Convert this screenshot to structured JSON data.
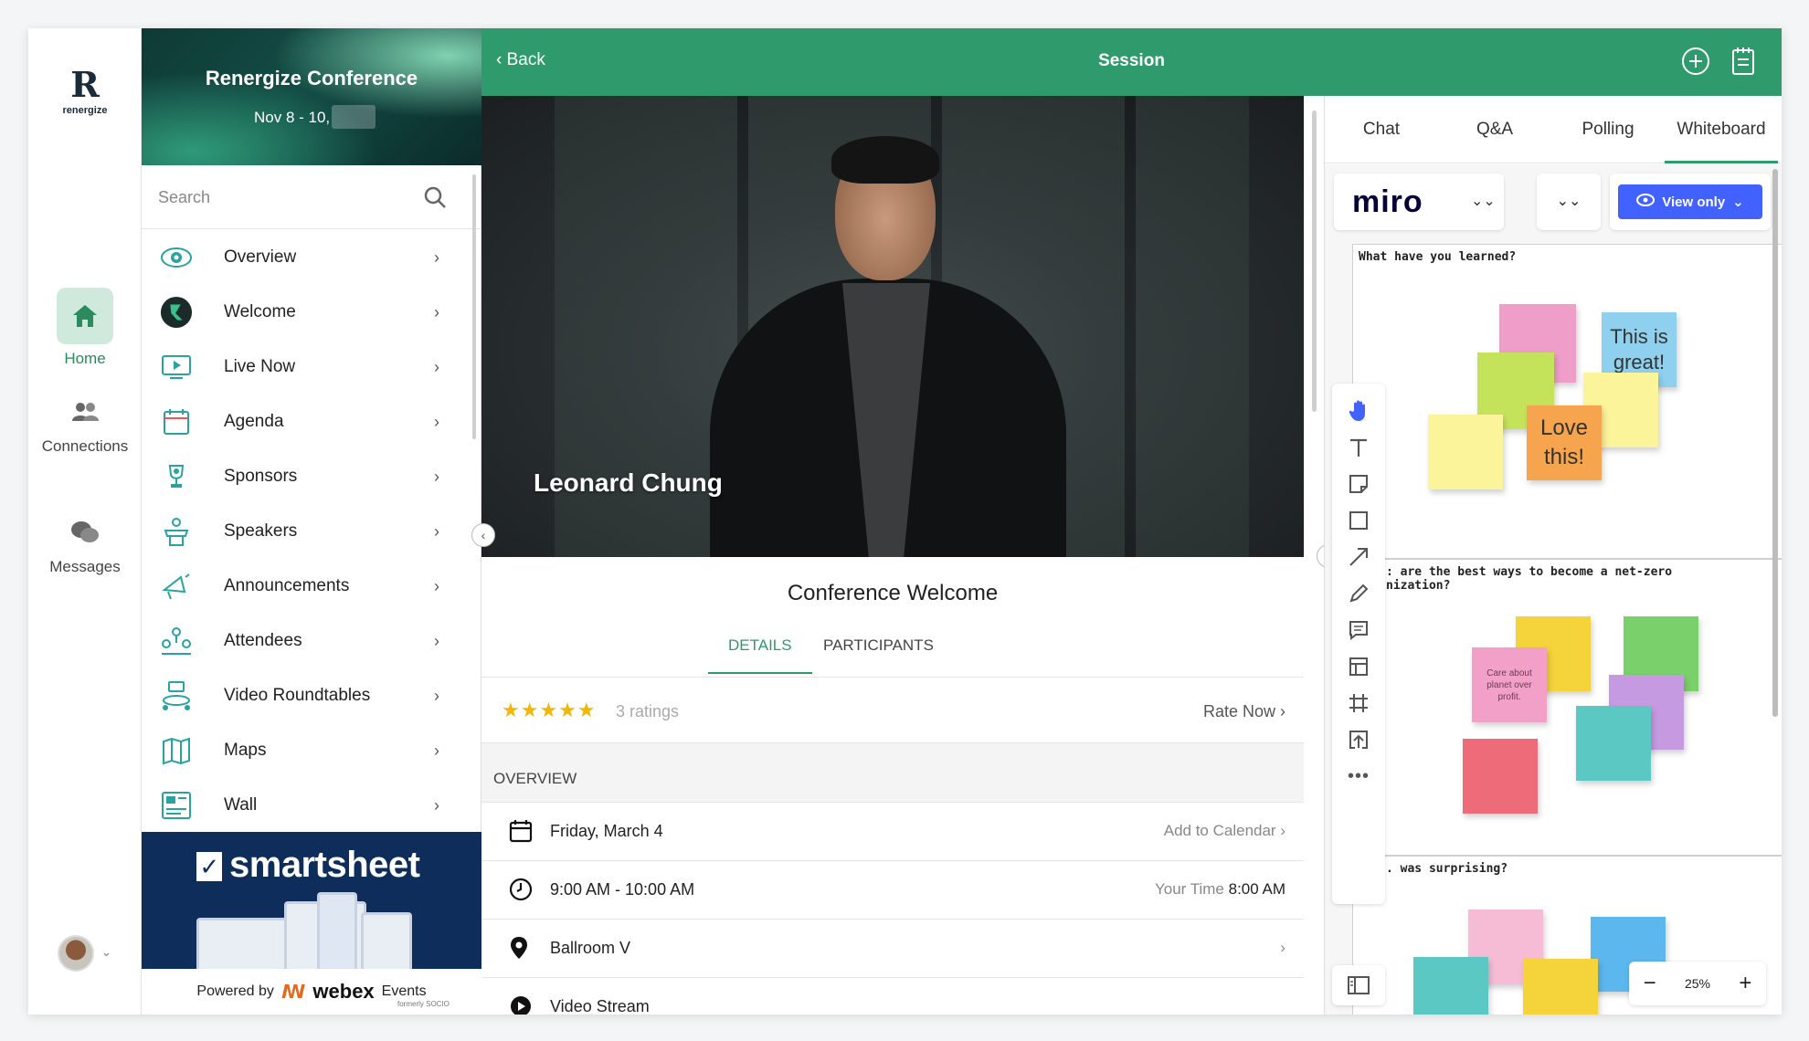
{
  "rail": {
    "logo_text": "renergize",
    "items": [
      {
        "label": "Home",
        "icon": "home-icon"
      },
      {
        "label": "Connections",
        "icon": "people-icon"
      },
      {
        "label": "Messages",
        "icon": "chat-bubbles-icon"
      }
    ]
  },
  "event": {
    "title": "Renergize Conference",
    "dates": "Nov 8 - 10,"
  },
  "search": {
    "placeholder": "Search"
  },
  "nav": {
    "items": [
      {
        "label": "Overview",
        "icon": "eye-icon"
      },
      {
        "label": "Welcome",
        "icon": "renergize-logo-icon"
      },
      {
        "label": "Live Now",
        "icon": "monitor-play-icon"
      },
      {
        "label": "Agenda",
        "icon": "calendar-icon"
      },
      {
        "label": "Sponsors",
        "icon": "trophy-icon"
      },
      {
        "label": "Speakers",
        "icon": "podium-icon"
      },
      {
        "label": "Announcements",
        "icon": "megaphone-icon"
      },
      {
        "label": "Attendees",
        "icon": "attendees-icon"
      },
      {
        "label": "Video Roundtables",
        "icon": "roundtable-icon"
      },
      {
        "label": "Maps",
        "icon": "map-icon"
      },
      {
        "label": "Wall",
        "icon": "wall-icon"
      }
    ]
  },
  "ad": {
    "brand": "smartsheet",
    "powered_by": "Powered by",
    "webex": "webex",
    "events": "Events",
    "formerly": "formerly SOCIO"
  },
  "header": {
    "back_label": "Back",
    "title": "Session"
  },
  "video": {
    "speaker_name": "Leonard Chung"
  },
  "session": {
    "title": "Conference Welcome",
    "tabs": [
      "DETAILS",
      "PARTICIPANTS"
    ],
    "rating": {
      "stars": 5,
      "count_label": "3 ratings",
      "rate_now": "Rate Now"
    },
    "overview_label": "OVERVIEW",
    "rows": [
      {
        "icon": "calendar-icon",
        "text": "Friday, March 4",
        "right": "Add to Calendar"
      },
      {
        "icon": "clock-icon",
        "text": "9:00 AM - 10:00 AM",
        "right_label": "Your Time",
        "right_value": "8:00 AM"
      },
      {
        "icon": "location-pin-icon",
        "text": "Ballroom V"
      },
      {
        "icon": "play-circle-icon",
        "text": "Video Stream"
      }
    ]
  },
  "right_panel": {
    "tabs": [
      "Chat",
      "Q&A",
      "Polling",
      "Whiteboard"
    ],
    "active_tab": "Whiteboard",
    "miro_logo": "miro",
    "view_only_label": "View only",
    "zoom_label": "25%",
    "frames": [
      {
        "question": "What have you learned?"
      },
      {
        "question": ": are the best ways to become a net-zero\nnization?"
      },
      {
        "question": ". was surprising?"
      }
    ],
    "notes": {
      "great": "This is great!",
      "love": "Love this!",
      "care": "Care about planet over profit."
    }
  },
  "colors": {
    "brand_green": "#2f9a6b",
    "miro_blue": "#4262ff",
    "ad_navy": "#0e2d5a",
    "star": "#f2b705"
  }
}
